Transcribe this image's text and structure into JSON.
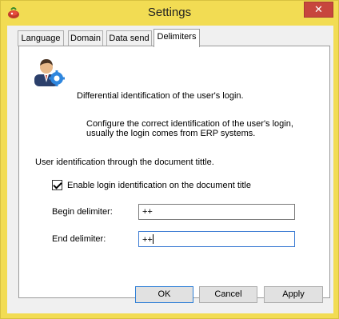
{
  "window": {
    "title": "Settings",
    "close_glyph": "✕"
  },
  "tabs": [
    {
      "label": "Language",
      "active": false
    },
    {
      "label": "Domain",
      "active": false
    },
    {
      "label": "Data send",
      "active": false
    },
    {
      "label": "Delimiters",
      "active": true
    }
  ],
  "panel": {
    "heading": "Differential identification of the user's login.",
    "description_line1": "Configure the correct identification of the user's login,",
    "description_line2": "usually the login comes from ERP systems.",
    "section_label": "User identification through the document tittle.",
    "checkbox": {
      "label": "Enable login identification on the document title",
      "checked": true
    },
    "begin_delimiter": {
      "label": "Begin delimiter:",
      "value": "++"
    },
    "end_delimiter": {
      "label": "End delimiter:",
      "value": "++"
    }
  },
  "buttons": {
    "ok": "OK",
    "cancel": "Cancel",
    "apply": "Apply"
  },
  "colors": {
    "titlebar": "#f2dc53",
    "close": "#c7463d",
    "accent": "#2f7fd6"
  }
}
